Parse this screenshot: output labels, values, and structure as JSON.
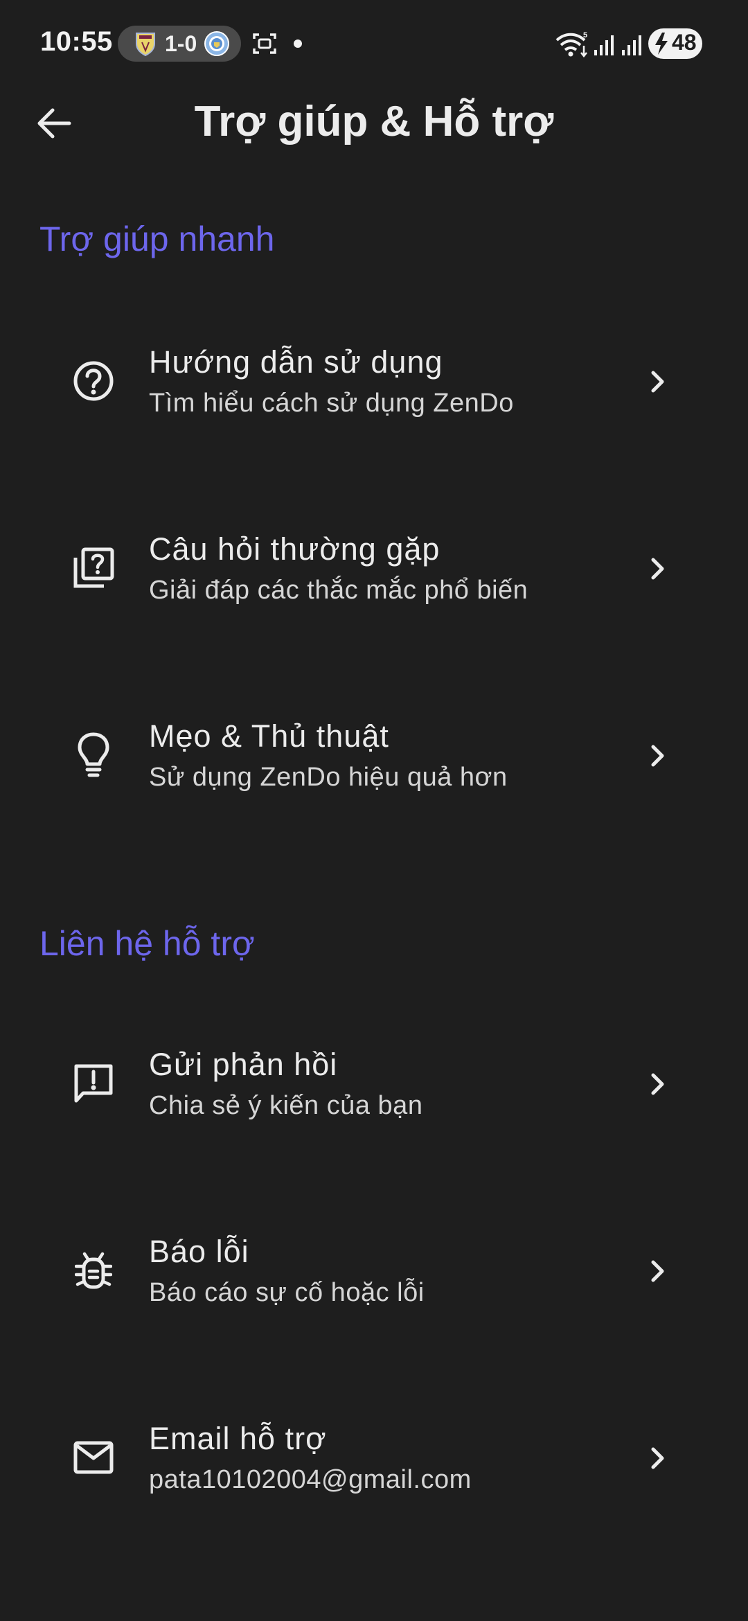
{
  "status_bar": {
    "time": "10:55",
    "match_score": "1-0",
    "battery_level": "48",
    "icons": [
      "team-crest-icon",
      "team-crest-icon",
      "screen-record-icon",
      "wifi-icon",
      "signal-icon",
      "signal-icon",
      "battery-charging-icon"
    ]
  },
  "app_bar": {
    "title": "Trợ giúp & Hỗ trợ",
    "back_icon": "arrow-back-icon"
  },
  "quick_help": {
    "header": "Trợ giúp nhanh",
    "items": [
      {
        "icon": "help-circle-icon",
        "title": "Hướng dẫn sử dụng",
        "subtitle": "Tìm hiểu cách sử dụng ZenDo"
      },
      {
        "icon": "faq-library-icon",
        "title": "Câu hỏi thường gặp",
        "subtitle": "Giải đáp các thắc mắc phổ biến"
      },
      {
        "icon": "lightbulb-icon",
        "title": "Mẹo & Thủ thuật",
        "subtitle": "Sử dụng ZenDo hiệu quả hơn"
      }
    ]
  },
  "contact": {
    "header": "Liên hệ hỗ trợ",
    "items": [
      {
        "icon": "feedback-icon",
        "title": "Gửi phản hồi",
        "subtitle": "Chia sẻ ý kiến của bạn"
      },
      {
        "icon": "bug-icon",
        "title": "Báo lỗi",
        "subtitle": "Báo cáo sự cố hoặc lỗi"
      },
      {
        "icon": "mail-icon",
        "title": "Email hỗ trợ",
        "subtitle": "pata10102004@gmail.com"
      }
    ]
  },
  "colors": {
    "background": "#1e1e1e",
    "accent": "#6d66ec",
    "text_primary": "#ececec",
    "text_secondary": "#d6d6d6"
  }
}
